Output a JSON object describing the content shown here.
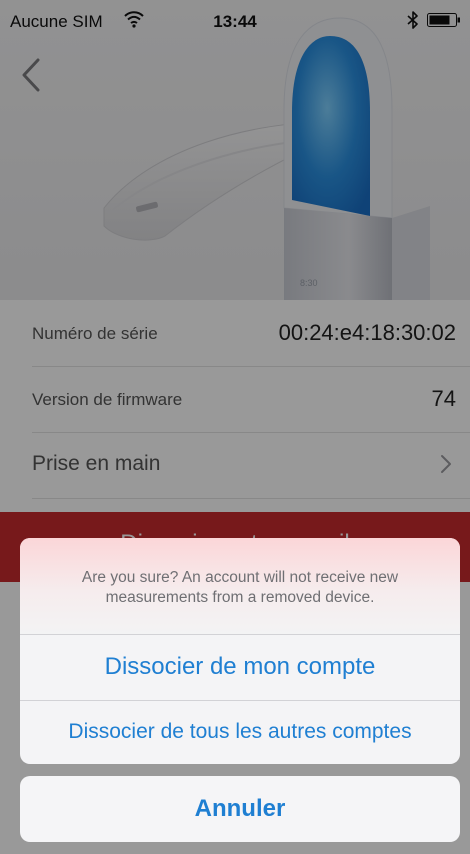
{
  "status_bar": {
    "carrier": "Aucune SIM",
    "time": "13:44",
    "icons": [
      "wifi-icon",
      "bluetooth-icon",
      "battery-icon"
    ]
  },
  "hero": {
    "back_icon": "chevron-left-icon",
    "image": "aura-sleep-device"
  },
  "device_info": {
    "serial_label": "Numéro de série",
    "serial_value": "00:24:e4:18:30:02",
    "firmware_label": "Version de firmware",
    "firmware_value": "74",
    "getting_started_label": "Prise en main",
    "getting_started_icon": "chevron-right-icon"
  },
  "remove_band": {
    "label": "Dissocier cet appareil"
  },
  "action_sheet": {
    "message": "Are you sure? An account will not receive new measurements from a removed device.",
    "actions": [
      "Dissocier de mon compte",
      "Dissocier de tous les autres comptes"
    ],
    "cancel": "Annuler"
  },
  "colors": {
    "accent": "#1f7fd2",
    "destructive_band": "#c62a2e",
    "device_glow": "#2a8fe0"
  }
}
